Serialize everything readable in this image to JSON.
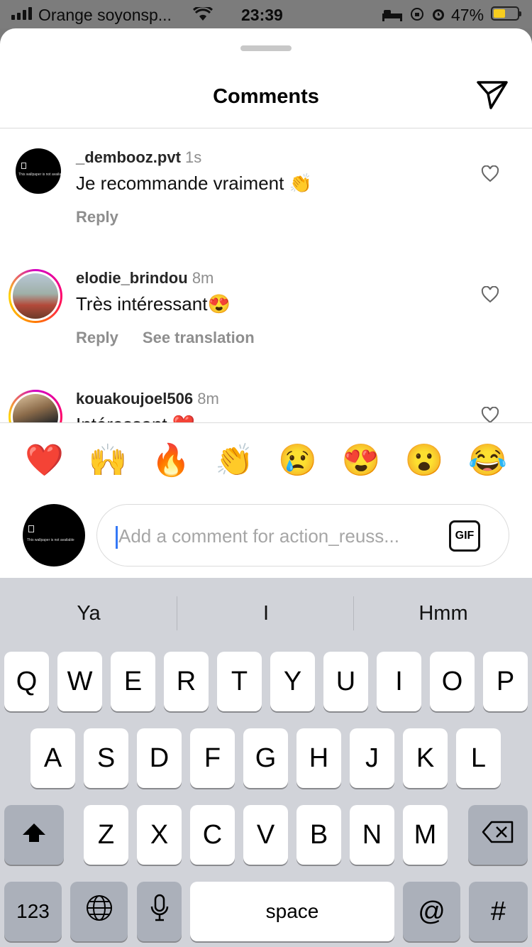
{
  "status_bar": {
    "carrier": "Orange soyonsp...",
    "time": "23:39",
    "battery": "47%"
  },
  "sheet": {
    "title": "Comments",
    "send_icon": "paper-plane-icon"
  },
  "comments": [
    {
      "username": "_dembooz.pvt",
      "age": "1s",
      "text": "Je recommande vraiment 👏",
      "actions": [
        "Reply"
      ]
    },
    {
      "username": "elodie_brindou",
      "age": "8m",
      "text": "Très intéressant😍",
      "actions": [
        "Reply",
        "See translation"
      ]
    },
    {
      "username": "kouakoujoel506",
      "age": "8m",
      "text": "Intéressant ❤️",
      "actions": []
    }
  ],
  "avatar_text": "This wallpaper is not available",
  "reactions": [
    "❤️",
    "🙌",
    "🔥",
    "👏",
    "😢",
    "😍",
    "😮",
    "😂"
  ],
  "composer": {
    "placeholder": "Add a comment for action_reuss...",
    "gif_label": "GIF"
  },
  "keyboard": {
    "suggestions": [
      "Ya",
      "I",
      "Hmm"
    ],
    "row1": [
      "Q",
      "W",
      "E",
      "R",
      "T",
      "Y",
      "U",
      "I",
      "O",
      "P"
    ],
    "row2": [
      "A",
      "S",
      "D",
      "F",
      "G",
      "H",
      "J",
      "K",
      "L"
    ],
    "row3": [
      "Z",
      "X",
      "C",
      "V",
      "B",
      "N",
      "M"
    ],
    "numbers_label": "123",
    "space_label": "space",
    "at_label": "@",
    "hash_label": "#"
  }
}
